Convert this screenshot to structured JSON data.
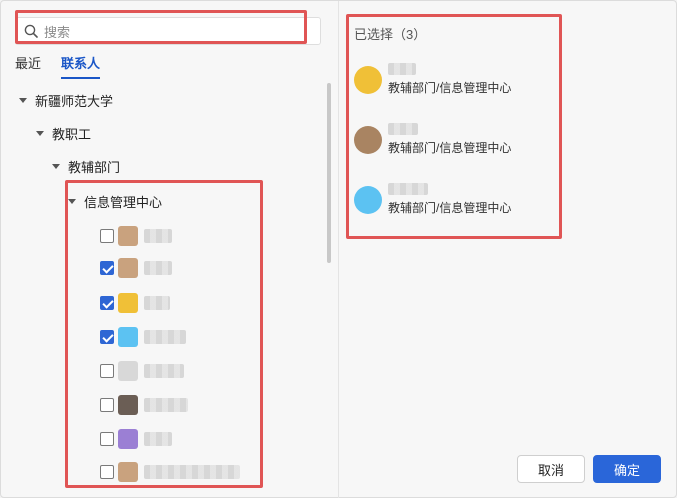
{
  "search": {
    "placeholder": "搜索"
  },
  "tabs": [
    {
      "label": "最近",
      "active": false
    },
    {
      "label": "联系人",
      "active": true
    }
  ],
  "tree": {
    "university": "新疆师范大学",
    "staff": "教职工",
    "department": "教辅部门",
    "center": "信息管理中心"
  },
  "contacts": [
    {
      "checked": false,
      "avatar_color": "#c9a27e"
    },
    {
      "checked": true,
      "avatar_color": "#c9a27e"
    },
    {
      "checked": true,
      "avatar_color": "#f0c037"
    },
    {
      "checked": true,
      "avatar_color": "#5cc2f2"
    },
    {
      "checked": false,
      "avatar_color": "#d8d8d8"
    },
    {
      "checked": false,
      "avatar_color": "#6b5e55"
    },
    {
      "checked": false,
      "avatar_color": "#9b7fd4"
    },
    {
      "checked": false,
      "avatar_color": "#c9a27e"
    }
  ],
  "selected_panel": {
    "title": "已选择（3）",
    "items": [
      {
        "dept": "教辅部门/信息管理中心",
        "avatar_color": "#f0c037"
      },
      {
        "dept": "教辅部门/信息管理中心",
        "avatar_color": "#a98462"
      },
      {
        "dept": "教辅部门/信息管理中心",
        "avatar_color": "#5cc2f2"
      }
    ]
  },
  "buttons": {
    "cancel": "取消",
    "ok": "确定"
  },
  "colors": {
    "accent": "#2a66d9",
    "highlight": "#e05555"
  }
}
